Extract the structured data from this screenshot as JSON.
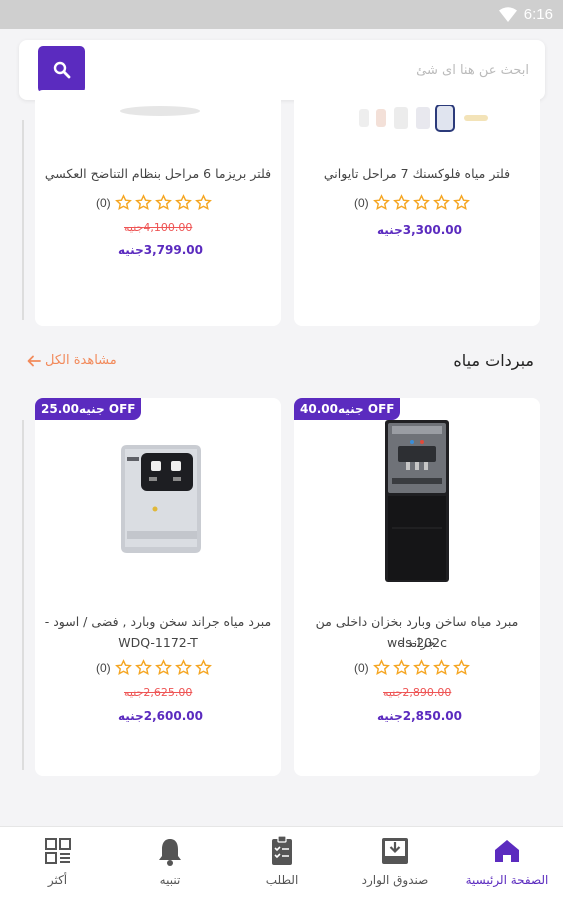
{
  "status_bar": {
    "time": "6:16"
  },
  "search": {
    "placeholder": "ابحث عن هنا اى شئ"
  },
  "top_products": [
    {
      "title": "فلتر مياه فلوكسنك 7 مراحل تايواني",
      "rating_count": "(0)",
      "price": "3,300.00جنيه"
    },
    {
      "title": "فلتر بريزما 6 مراحل بنظام التناضح العكسي",
      "rating_count": "(0)",
      "old_price": "4,100.00جنيه",
      "price": "3,799.00جنيه"
    }
  ],
  "section": {
    "title": "مبردات مياه",
    "see_all": "مشاهدة الكل"
  },
  "products": [
    {
      "badge": "40.00جنيه OFF",
      "title_line1": "مبرد مياه ساخن وبارد بخزان داخلى من جراند -",
      "title_line2": "wds-202c",
      "rating_count": "(0)",
      "old_price": "2,890.00جنيه",
      "price": "2,850.00جنيه"
    },
    {
      "badge": "25.00جنيه OFF",
      "title_line1": "مبرد مياه جراند سخن وبارد , فضى / اسود -",
      "title_line2": "WDQ-1172-T",
      "rating_count": "(0)",
      "old_price": "2,625.00جنيه",
      "price": "2,600.00جنيه"
    }
  ],
  "nav": [
    {
      "label": "الصفحة الرئيسية",
      "icon": "home-icon",
      "active": true
    },
    {
      "label": "صندوق الوارد",
      "icon": "inbox-icon"
    },
    {
      "label": "الطلب",
      "icon": "clipboard-icon"
    },
    {
      "label": "تنبيه",
      "icon": "bell-icon"
    },
    {
      "label": "أكثر",
      "icon": "grid-icon"
    }
  ],
  "colors": {
    "accent": "#5b2bbf",
    "star": "#f5a623",
    "old_price": "#e55555",
    "link": "#f28a5b"
  }
}
